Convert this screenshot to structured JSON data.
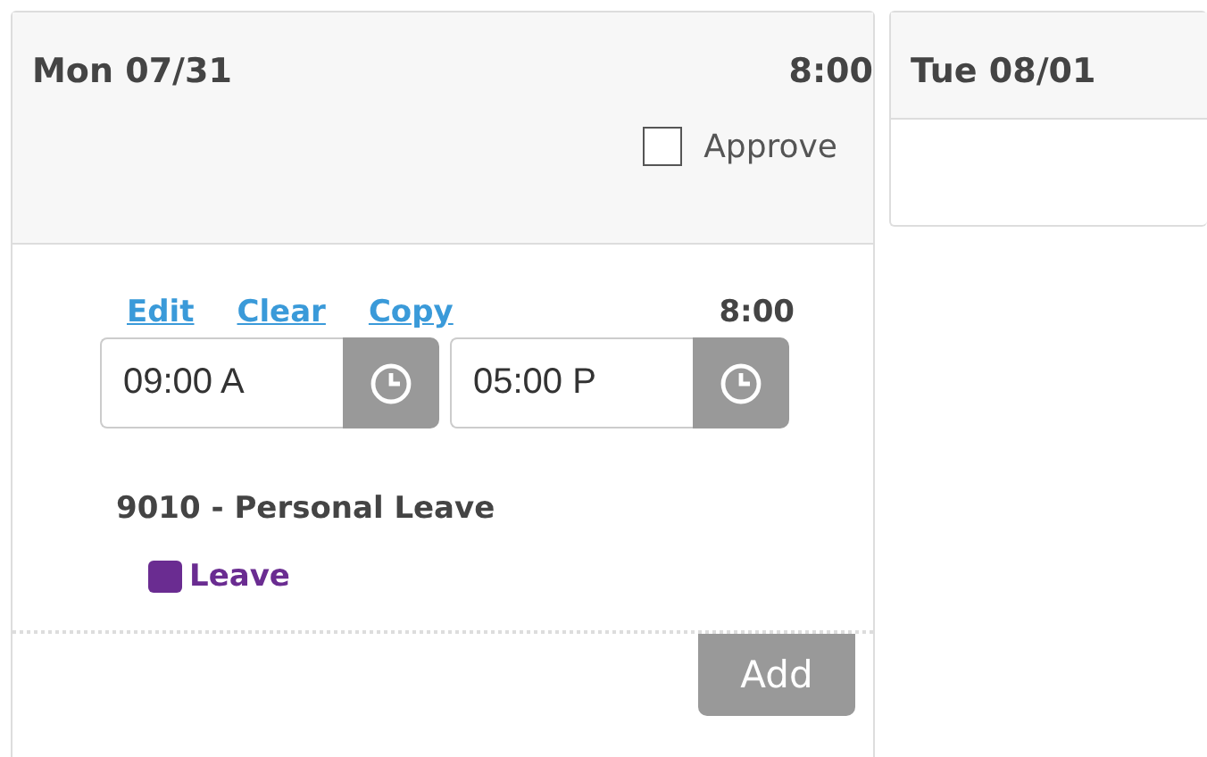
{
  "days": [
    {
      "kind": "detail",
      "label": "Mon 07/31",
      "total": "8:00",
      "approve": {
        "label": "Approve",
        "checked": false
      },
      "entry": {
        "actions": [
          "Edit",
          "Clear",
          "Copy"
        ],
        "hours": "8:00",
        "start": "09:00 A",
        "end": "05:00 P",
        "project": "9010 - Personal Leave",
        "tag": {
          "label": "Leave",
          "color": "#6a2c91"
        }
      },
      "add_button": "Add"
    },
    {
      "kind": "empty",
      "label": "Tue 08/01"
    }
  ]
}
